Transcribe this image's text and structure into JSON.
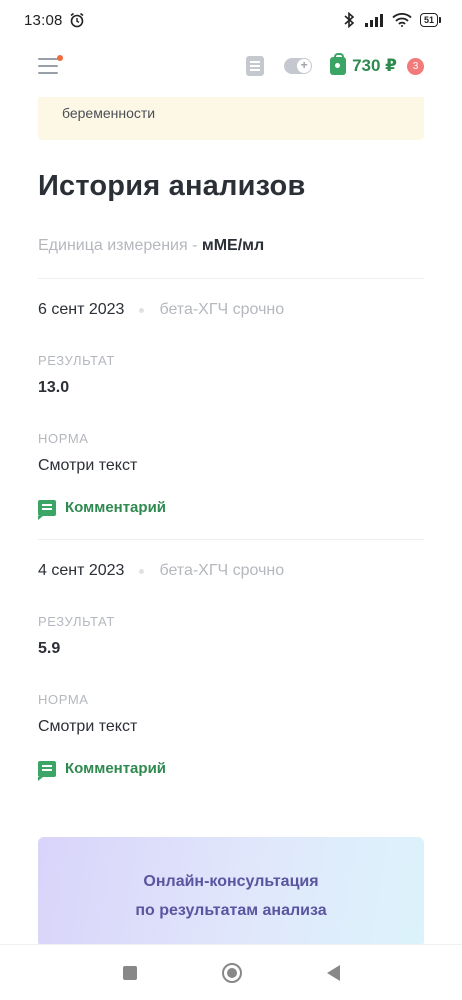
{
  "status_bar": {
    "time": "13:08",
    "battery": "51"
  },
  "header": {
    "balance": "730 ₽",
    "badge_count": "3"
  },
  "notice": {
    "text": "беременности"
  },
  "main": {
    "title": "История анализов",
    "unit_label": "Единица измерения - ",
    "unit_value": "мМЕ/мл",
    "entries": [
      {
        "date": "6 сент 2023",
        "test_name": "бета-ХГЧ срочно",
        "result_label": "РЕЗУЛЬТАТ",
        "result_value": "13.0",
        "norm_label": "НОРМА",
        "norm_value": "Смотри текст",
        "comment_label": "Комментарий"
      },
      {
        "date": "4 сент 2023",
        "test_name": "бета-ХГЧ срочно",
        "result_label": "РЕЗУЛЬТАТ",
        "result_value": "5.9",
        "norm_label": "НОРМА",
        "norm_value": "Смотри текст",
        "comment_label": "Комментарий"
      }
    ]
  },
  "promo": {
    "line1": "Онлайн-консультация",
    "line2": "по результатам анализа"
  },
  "colors": {
    "accent_green": "#2f8a50",
    "badge_red": "#f27a7a",
    "notice_bg": "#fdf8e6",
    "promo_text": "#5a55a0"
  }
}
